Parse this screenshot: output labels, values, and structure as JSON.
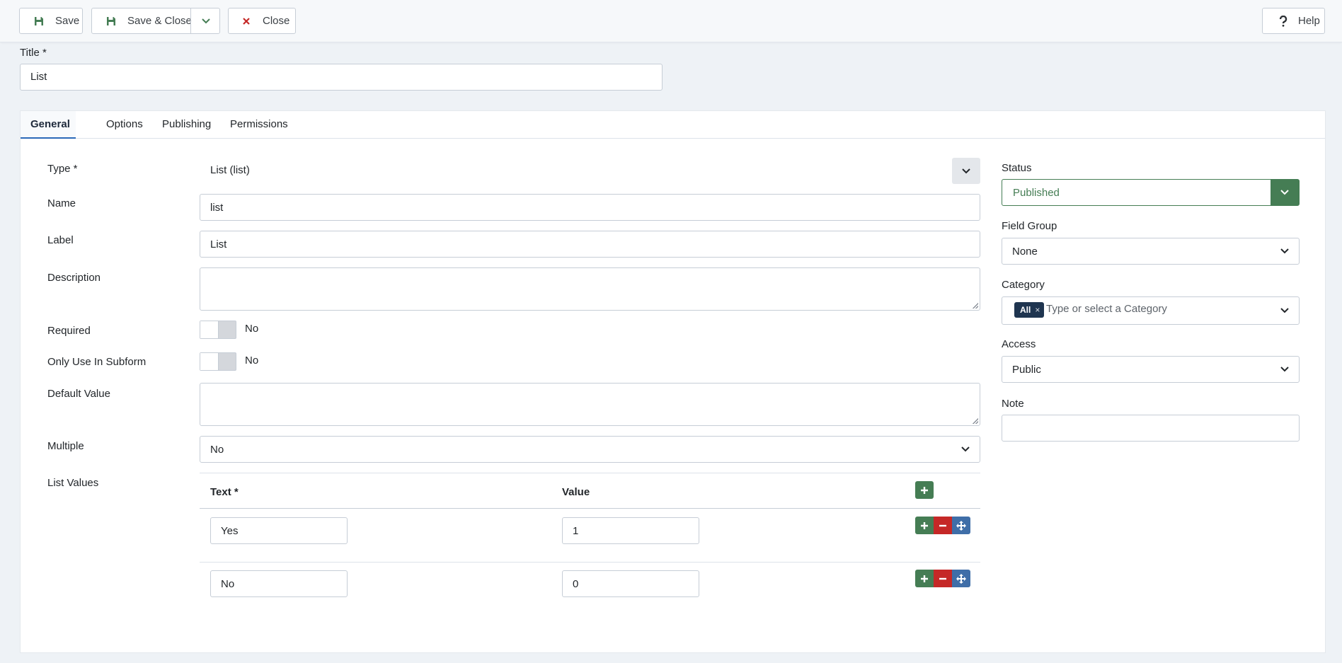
{
  "toolbar": {
    "save_label": "Save",
    "save_close_label": "Save & Close",
    "close_label": "Close",
    "help_label": "Help"
  },
  "title": {
    "label": "Title *",
    "value": "List"
  },
  "tabs": [
    {
      "label": "General",
      "active": true
    },
    {
      "label": "Options"
    },
    {
      "label": "Publishing"
    },
    {
      "label": "Permissions"
    }
  ],
  "general": {
    "type": {
      "label": "Type *",
      "value": "List (list)"
    },
    "name": {
      "label": "Name",
      "value": "list"
    },
    "field_label": {
      "label": "Label",
      "value": "List"
    },
    "description": {
      "label": "Description",
      "value": ""
    },
    "required": {
      "label": "Required",
      "state": "No"
    },
    "only_subform": {
      "label": "Only Use In Subform",
      "state": "No"
    },
    "default_value": {
      "label": "Default Value",
      "value": ""
    },
    "multiple": {
      "label": "Multiple",
      "value": "No"
    },
    "list_values": {
      "label": "List Values",
      "col_text": "Text *",
      "col_value": "Value",
      "rows": [
        {
          "text": "Yes",
          "value": "1"
        },
        {
          "text": "No",
          "value": "0"
        }
      ]
    }
  },
  "sidebar": {
    "status": {
      "label": "Status",
      "value": "Published"
    },
    "field_group": {
      "label": "Field Group",
      "value": "None"
    },
    "category": {
      "label": "Category",
      "chip": "All",
      "chip_remove": "×",
      "placeholder": "Type or select a Category"
    },
    "access": {
      "label": "Access",
      "value": "Public"
    },
    "note": {
      "label": "Note",
      "value": ""
    }
  },
  "colors": {
    "accent_green": "#457d54",
    "danger_red": "#c52827",
    "move_blue": "#3f6ea8",
    "tab_active": "#2a69b8"
  },
  "icons": {
    "save": "floppy-disk-icon",
    "close": "x-icon",
    "help": "question-mark-icon",
    "add": "plus-icon",
    "remove": "minus-icon",
    "move": "move-arrows-icon",
    "dropdown": "chevron-down-icon"
  }
}
